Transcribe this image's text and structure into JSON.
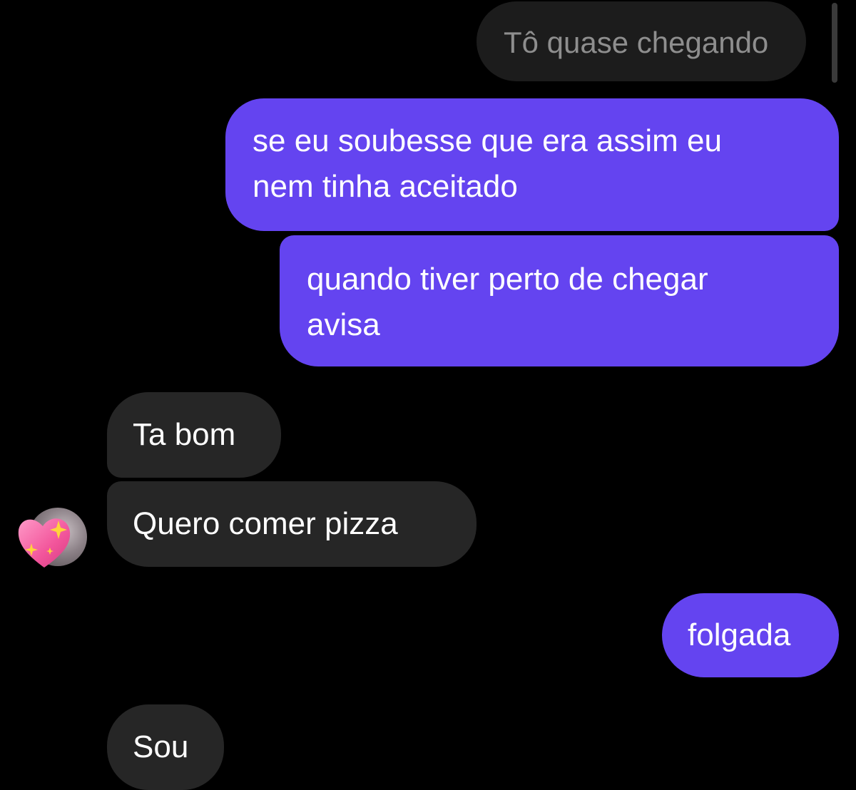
{
  "conversation": {
    "messages": [
      {
        "sender": "contact",
        "text": "Tô quase chegando",
        "faded": true
      },
      {
        "sender": "me",
        "lines": [
          "se eu soubesse que era assim eu",
          "nem tinha aceitado"
        ]
      },
      {
        "sender": "me",
        "lines": [
          "quando tiver perto de chegar",
          "avisa"
        ]
      },
      {
        "sender": "contact",
        "text": "Ta bom"
      },
      {
        "sender": "contact",
        "text": "Quero comer pizza"
      },
      {
        "sender": "me",
        "text": "folgada"
      },
      {
        "sender": "contact",
        "text": "Sou"
      }
    ],
    "contact_avatar_icon": "sparkling-heart-icon"
  },
  "colors": {
    "background": "#000000",
    "outgoing_bubble": "#6444f0",
    "incoming_bubble": "#262626",
    "text": "#ffffff"
  }
}
